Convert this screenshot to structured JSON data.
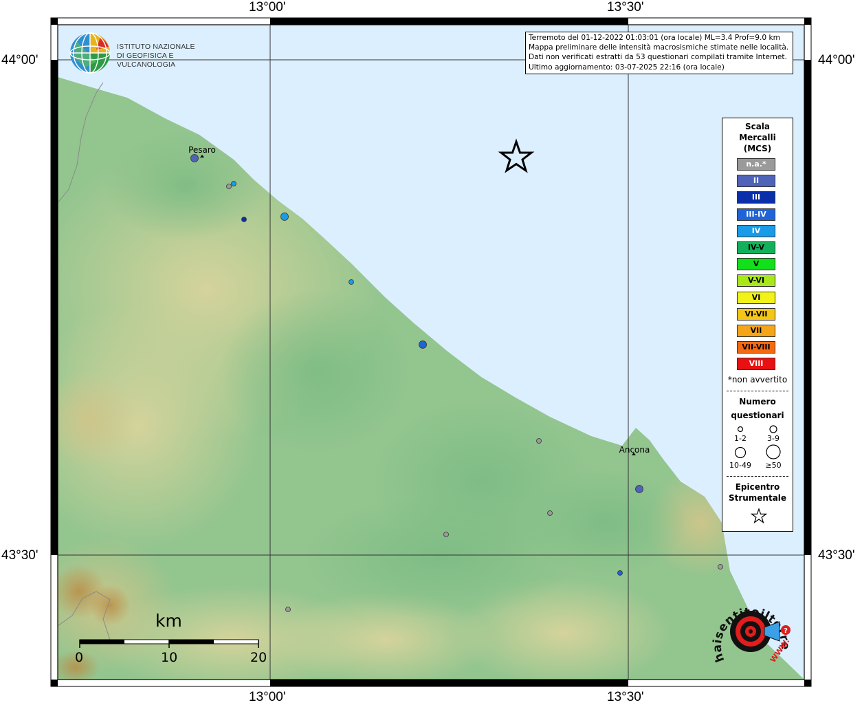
{
  "map": {
    "lon_labels": [
      "13°00'",
      "13°30'"
    ],
    "lat_labels": [
      "44°00'",
      "43°30'"
    ],
    "places": [
      {
        "name": "Pesaro"
      },
      {
        "name": "Ancona"
      }
    ],
    "colors": {
      "sea": "#dcefff",
      "land": "#8cc08a",
      "lowland": "#a8cc90",
      "hills": "#d9d49a",
      "frame": "#000000",
      "grid": "#333333",
      "border": "#8a8a8a"
    }
  },
  "observations": [
    {
      "place": "Pesaro",
      "intensity": "II",
      "size": "3-9"
    },
    {
      "intensity": "n.a.*",
      "size": "1-2"
    },
    {
      "intensity": "IV",
      "size": "1-2"
    },
    {
      "intensity": "III",
      "size": "1-2"
    },
    {
      "intensity": "IV",
      "size": "3-9"
    },
    {
      "intensity": "IV",
      "size": "1-2"
    },
    {
      "intensity": "III-IV",
      "size": "3-9"
    },
    {
      "intensity": "n.a.*",
      "size": "1-2"
    },
    {
      "place": "Ancona",
      "intensity": "II",
      "size": "3-9"
    },
    {
      "intensity": "n.a.*",
      "size": "1-2"
    },
    {
      "intensity": "n.a.*",
      "size": "1-2"
    },
    {
      "intensity": "III-IV",
      "size": "1-2"
    },
    {
      "intensity": "n.a.*",
      "size": "1-2"
    },
    {
      "intensity": "n.a.*",
      "size": "1-2"
    }
  ],
  "info": {
    "line1": "Terremoto del 01-12-2022 01:03:01 (ora locale) ML=3.4 Prof=9.0 km",
    "line2": "Mappa preliminare delle intensità macrosismiche stimate nelle località.",
    "line3": "Dati non verificati estratti da 53 questionari compilati tramite Internet.",
    "line4": "Ultimo aggiornamento: 03-07-2025 22:16 (ora locale)"
  },
  "logo": {
    "line1": "ISTITUTO NAZIONALE",
    "line2": "DI GEOFISICA E VULCANOLOGIA"
  },
  "legend": {
    "title_lines": [
      "Scala",
      "Mercalli",
      "(MCS)"
    ],
    "items": [
      {
        "label": "n.a.*",
        "color": "#9a9a9a",
        "text_color": "#ffffff"
      },
      {
        "label": "II",
        "color": "#4f63b8",
        "text_color": "#ffffff"
      },
      {
        "label": "III",
        "color": "#0a2fa8",
        "text_color": "#ffffff"
      },
      {
        "label": "III-IV",
        "color": "#1e63d8",
        "text_color": "#ffffff"
      },
      {
        "label": "IV",
        "color": "#1a9be8",
        "text_color": "#ffffff"
      },
      {
        "label": "IV-V",
        "color": "#12b05a",
        "text_color": "#000000"
      },
      {
        "label": "V",
        "color": "#11e01a",
        "text_color": "#000000"
      },
      {
        "label": "V-VI",
        "color": "#a8e81a",
        "text_color": "#000000"
      },
      {
        "label": "VI",
        "color": "#f2f21a",
        "text_color": "#000000"
      },
      {
        "label": "VI-VII",
        "color": "#f5c518",
        "text_color": "#000000"
      },
      {
        "label": "VII",
        "color": "#f5a518",
        "text_color": "#000000"
      },
      {
        "label": "VII-VIII",
        "color": "#f46a12",
        "text_color": "#000000"
      },
      {
        "label": "VIII",
        "color": "#e81010",
        "text_color": "#ffffff"
      }
    ],
    "not_felt_note": "*non avvertito",
    "count_title_lines": [
      "Numero",
      "questionari"
    ],
    "count_labels": [
      "1-2",
      "3-9",
      "10-49",
      "≥50"
    ],
    "epicenter_title_lines": [
      "Epicentro",
      "Strumentale"
    ]
  },
  "scalebar": {
    "unit": "km",
    "ticks": [
      "0",
      "10",
      "20"
    ]
  },
  "haisentito": {
    "ring_text": "haisentitoilterremoto.it",
    "url_text": "WWW."
  }
}
